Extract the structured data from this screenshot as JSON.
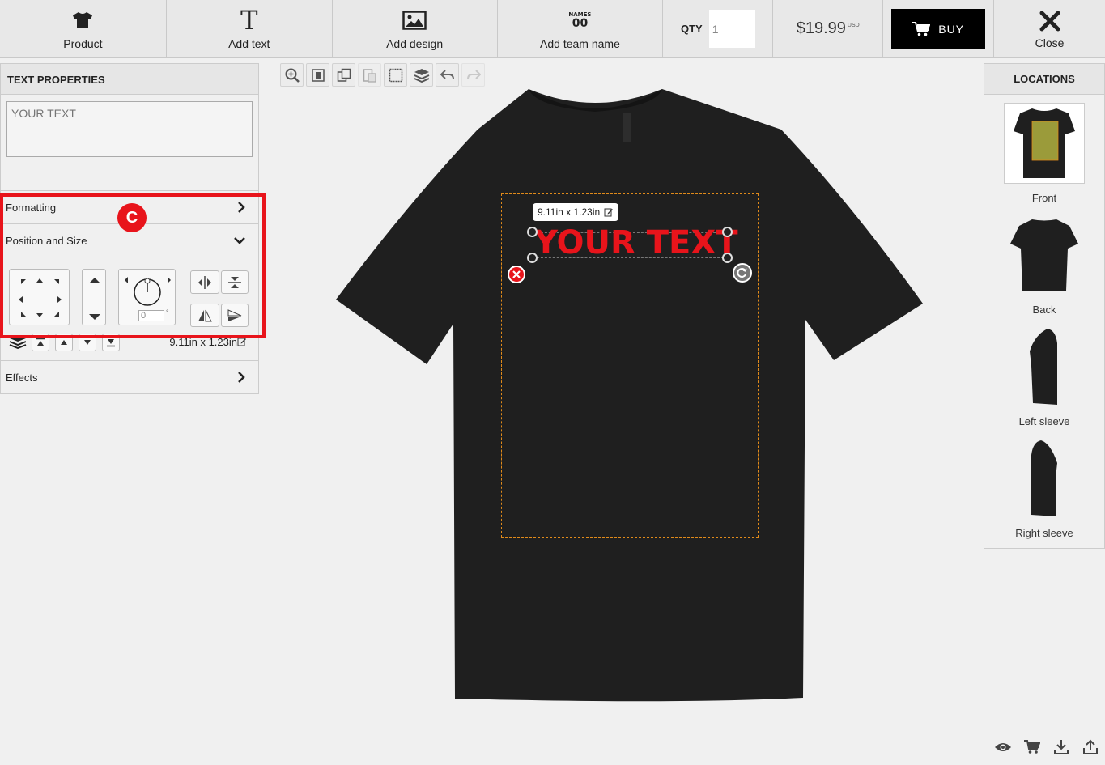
{
  "toolbar": {
    "product": {
      "label": "Product",
      "icon": "tshirt-icon"
    },
    "add_text": {
      "label": "Add text",
      "icon": "text-T-icon"
    },
    "add_design": {
      "label": "Add design",
      "icon": "image-icon"
    },
    "add_team_name": {
      "label": "Add team name",
      "icon": "names-numbers-icon",
      "icon_top": "NAMES",
      "icon_bottom": "00"
    },
    "qty_label": "QTY",
    "qty_value": "1",
    "price": "$19.99",
    "currency": "USD",
    "buy_label": "BUY",
    "close_label": "Close"
  },
  "left_panel": {
    "title": "TEXT PROPERTIES",
    "text_placeholder": "YOUR TEXT",
    "sections": {
      "formatting": "Formatting",
      "position_and_size": "Position and Size",
      "effects": "Effects"
    },
    "rotation_value": "0",
    "rotation_unit": "°",
    "size": "9.11in x 1.23in"
  },
  "annotation": {
    "badge": "C",
    "color": "#e8141b"
  },
  "canvas": {
    "text": "YOUR TEXT",
    "text_color": "#e8141b",
    "dimension_tip": "9.11in x 1.23in",
    "shirt_color": "#1f1f1f",
    "print_area_color": "#e08a1a"
  },
  "canvas_toolbar": [
    {
      "icon": "zoom-in-icon",
      "enabled": true
    },
    {
      "icon": "center-align-icon",
      "enabled": true
    },
    {
      "icon": "copy-icon",
      "enabled": true
    },
    {
      "icon": "paste-icon",
      "enabled": false
    },
    {
      "icon": "select-all-icon",
      "enabled": true
    },
    {
      "icon": "layers-icon",
      "enabled": true
    },
    {
      "icon": "undo-icon",
      "enabled": true
    },
    {
      "icon": "redo-icon",
      "enabled": false
    }
  ],
  "right_panel": {
    "title": "LOCATIONS",
    "locations": [
      {
        "label": "Front",
        "active": true
      },
      {
        "label": "Back",
        "active": false
      },
      {
        "label": "Left sleeve",
        "active": false
      },
      {
        "label": "Right sleeve",
        "active": false
      }
    ]
  },
  "bottom_icons": [
    "eye-icon",
    "cart-icon",
    "download-icon",
    "share-icon"
  ]
}
